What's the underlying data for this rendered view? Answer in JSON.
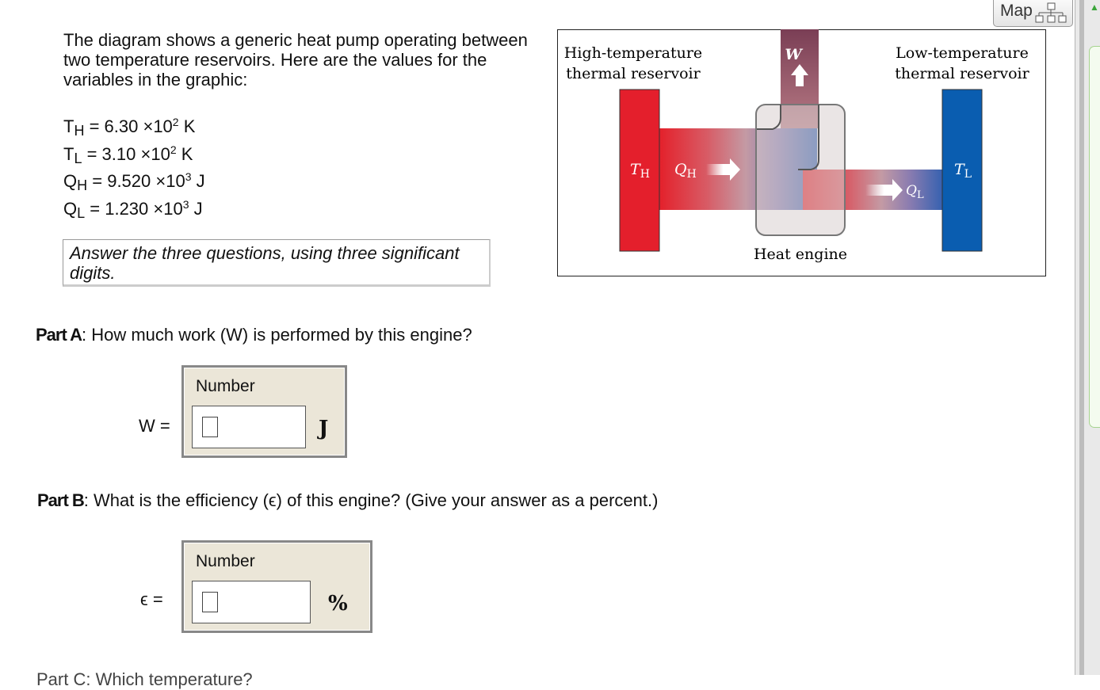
{
  "map_button": {
    "label": "Map",
    "icon": "sitemap-icon"
  },
  "intro": "The diagram shows a generic heat pump operating between two temperature reservoirs. Here are the values for the variables in the graphic:",
  "variables": [
    {
      "sym": "T",
      "sub": "H",
      "mant": "6.30",
      "exp": "2",
      "unit": "K"
    },
    {
      "sym": "T",
      "sub": "L",
      "mant": "3.10",
      "exp": "2",
      "unit": "K"
    },
    {
      "sym": "Q",
      "sub": "H",
      "mant": "9.520",
      "exp": "3",
      "unit": "J"
    },
    {
      "sym": "Q",
      "sub": "L",
      "mant": "1.230",
      "exp": "3",
      "unit": "J"
    }
  ],
  "note": "Answer the three questions, using three significant digits.",
  "figure": {
    "high_label_1": "High-temperature",
    "high_label_2": "thermal reservoir",
    "low_label_1": "Low-temperature",
    "low_label_2": "thermal reservoir",
    "w_label": "W",
    "th_label": "T",
    "th_sub": "H",
    "qh_label": "Q",
    "qh_sub": "H",
    "tl_label": "T",
    "tl_sub": "L",
    "ql_label": "Q",
    "ql_sub": "L",
    "engine_label": "Heat engine"
  },
  "part_a": {
    "label": "Part A",
    "question": ": How much work (W) is performed by this engine?",
    "input_label": "W =",
    "box_caption": "Number",
    "unit": "J"
  },
  "part_b": {
    "label": "Part B",
    "question": ": What is the efficiency (ϵ) of this engine? (Give your answer as a percent.)",
    "input_label": "ϵ =",
    "box_caption": "Number",
    "unit": "%"
  },
  "part_c_cutoff": "Part C: Which temperature?"
}
